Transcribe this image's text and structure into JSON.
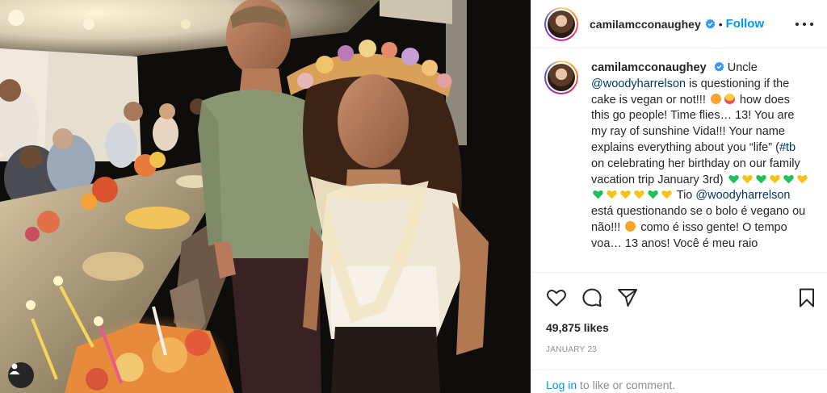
{
  "post": {
    "username": "camilamcconaughey",
    "verified": true,
    "separator": "•",
    "follow_label": "Follow",
    "more_icon": "more-horizontal-icon"
  },
  "caption": {
    "username": "camilamcconaughey",
    "t1": " Uncle ",
    "m1": "@woodyharrelson",
    "t2": " is questioning if the cake is vegan or not!!! ",
    "t3": " how does this go people! Time flies… 13! You are my ray of sunshine Vida!!! Your name explains everything about you “life” (",
    "tag": "#tb",
    "t4": " on celebrating her birthday on our family vacation trip January 3rd) ",
    "t5": " Tio ",
    "m2": "@woodyharrelson",
    "t6": " está questionando se o bolo é vegano ou não!!! ",
    "t7": " como é isso gente! O tempo voa… 13 anos! Você é meu raio"
  },
  "icons": {
    "like": "heart-icon",
    "comment": "comment-icon",
    "share": "send-icon",
    "save": "bookmark-icon",
    "user_tag": "user-icon"
  },
  "likes_text": "49,875 likes",
  "date_text": "JANUARY 23",
  "login": {
    "link": "Log in",
    "rest": " to like or comment."
  },
  "colors": {
    "accent": "#0095f6",
    "mention": "#00376b",
    "muted": "#8e8e8e",
    "green_heart": "#20c15a",
    "yellow_heart": "#f5c418",
    "emoji_face": "#f7a42a"
  }
}
